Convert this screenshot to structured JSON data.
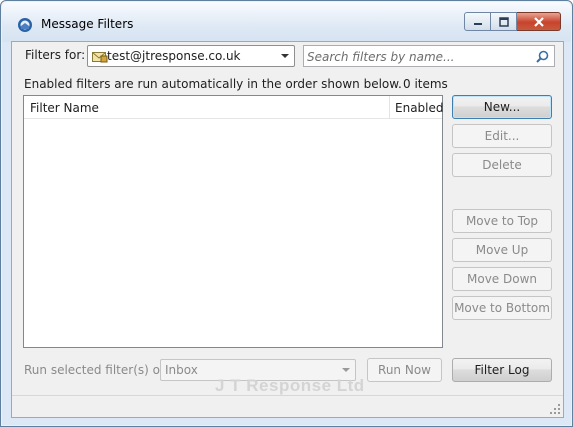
{
  "window": {
    "title": "Message Filters",
    "icons": {
      "app": "thunderbird-icon",
      "minimize": "minimize-icon",
      "maximize": "maximize-icon",
      "close": "close-icon"
    }
  },
  "filters_for": {
    "label": "Filters for:",
    "account": "test@jtresponse.co.uk",
    "account_icon": "mail-account-icon"
  },
  "search": {
    "placeholder": "Search filters by name...",
    "value": "",
    "icon": "search-icon"
  },
  "info": {
    "text": "Enabled filters are run automatically in the order shown below.",
    "count": "0 items"
  },
  "table": {
    "columns": [
      "Filter Name",
      "Enabled"
    ],
    "rows": []
  },
  "buttons": {
    "new": "New...",
    "edit": "Edit...",
    "delete": "Delete",
    "move_top": "Move to Top",
    "move_up": "Move Up",
    "move_down": "Move Down",
    "move_bottom": "Move to Bottom",
    "run_now": "Run Now",
    "filter_log": "Filter Log"
  },
  "run_on": {
    "label": "Run selected filter(s) on:",
    "folder": "Inbox"
  },
  "watermark": "J T Response Ltd",
  "colors": {
    "accent_border": "#3c7fb1",
    "close_button": "#c8432b",
    "disabled_text": "#8a8a8a"
  }
}
